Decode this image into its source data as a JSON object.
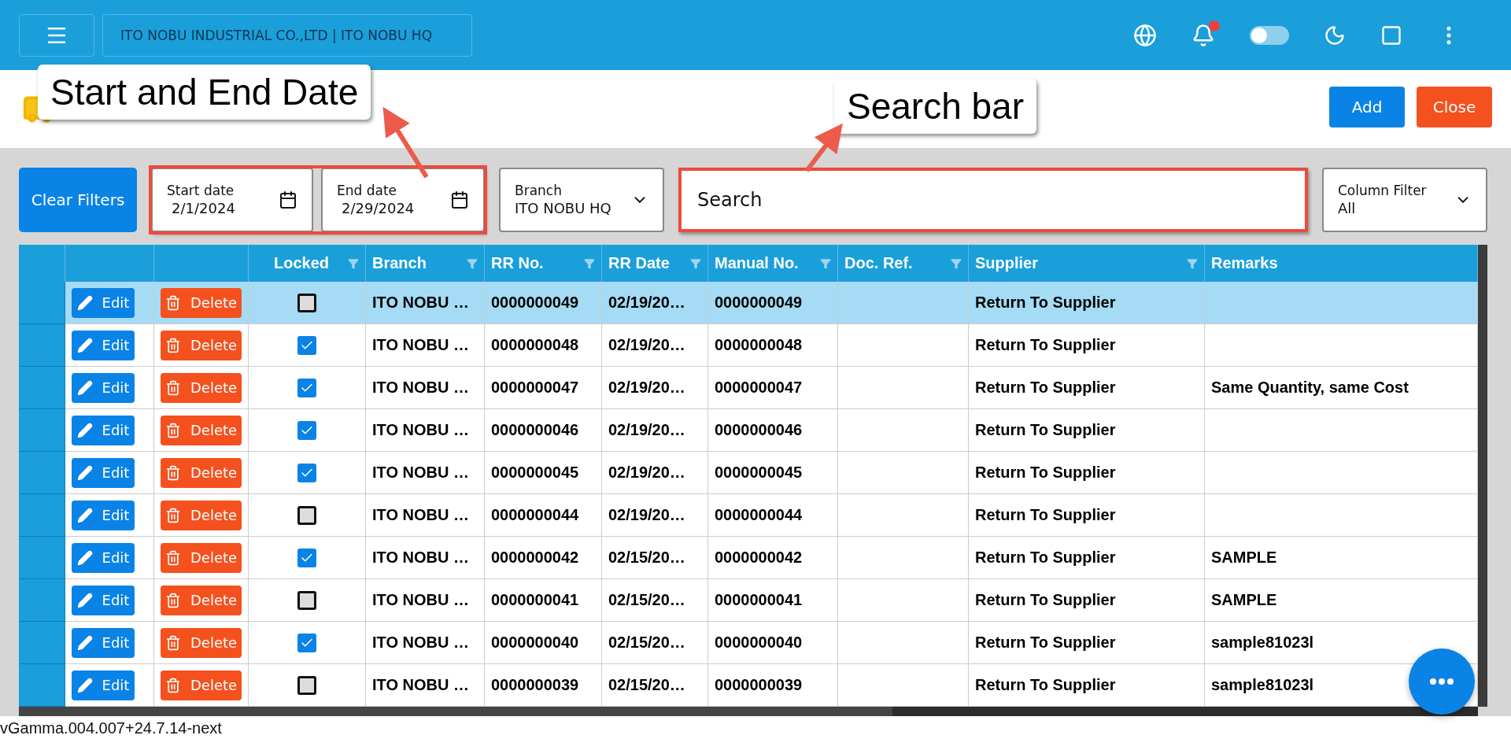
{
  "top_bar": {
    "company": "ITO NOBU INDUSTRIAL CO.,LTD | ITO NOBU HQ",
    "notification_badge": true,
    "toggle_on": false
  },
  "header": {
    "buttons": [
      {
        "kind": "primary",
        "label": "Add"
      },
      {
        "kind": "danger",
        "label": "Close"
      }
    ]
  },
  "filters": {
    "clear_button": "Clear Filters",
    "start_date": {
      "label": "Start date",
      "value": "2/1/2024"
    },
    "end_date": {
      "label": "End date",
      "value": "2/29/2024"
    },
    "branch": {
      "label": "Branch",
      "value": "ITO NOBU HQ"
    },
    "search": {
      "placeholder": "Search"
    },
    "column_filter": {
      "label": "Column Filter",
      "value": "All"
    }
  },
  "table": {
    "columns": [
      {
        "label": "Locked",
        "filter": true
      },
      {
        "label": "Branch",
        "filter": true
      },
      {
        "label": "RR No.",
        "filter": true
      },
      {
        "label": "RR Date",
        "filter": true
      },
      {
        "label": "Manual No.",
        "filter": true
      },
      {
        "label": "Doc. Ref.",
        "filter": true
      },
      {
        "label": "Supplier",
        "filter": true
      },
      {
        "label": "Remarks",
        "filter": false
      }
    ],
    "rows": [
      {
        "selected": true,
        "edit": "Edit",
        "delete": "Delete",
        "locked": false,
        "branch": "ITO NOBU …",
        "rr_no": "0000000049",
        "rr_date": "02/19/20…",
        "manual_no": "0000000049",
        "supplier": "Return To Supplier"
      },
      {
        "selected": false,
        "edit": "Edit",
        "delete": "Delete",
        "locked": true,
        "branch": "ITO NOBU …",
        "rr_no": "0000000048",
        "rr_date": "02/19/20…",
        "manual_no": "0000000048",
        "supplier": "Return To Supplier"
      },
      {
        "selected": false,
        "edit": "Edit",
        "delete": "Delete",
        "locked": true,
        "branch": "ITO NOBU …",
        "rr_no": "0000000047",
        "rr_date": "02/19/20…",
        "manual_no": "0000000047",
        "supplier": "Return To Supplier",
        "remarks": "Same Quantity, same Cost"
      },
      {
        "selected": false,
        "edit": "Edit",
        "delete": "Delete",
        "locked": true,
        "branch": "ITO NOBU …",
        "rr_no": "0000000046",
        "rr_date": "02/19/20…",
        "manual_no": "0000000046",
        "supplier": "Return To Supplier"
      },
      {
        "selected": false,
        "edit": "Edit",
        "delete": "Delete",
        "locked": true,
        "branch": "ITO NOBU …",
        "rr_no": "0000000045",
        "rr_date": "02/19/20…",
        "manual_no": "0000000045",
        "supplier": "Return To Supplier"
      },
      {
        "selected": false,
        "edit": "Edit",
        "delete": "Delete",
        "locked": false,
        "branch": "ITO NOBU …",
        "rr_no": "0000000044",
        "rr_date": "02/19/20…",
        "manual_no": "0000000044",
        "supplier": "Return To Supplier"
      },
      {
        "selected": false,
        "edit": "Edit",
        "delete": "Delete",
        "locked": true,
        "branch": "ITO NOBU …",
        "rr_no": "0000000042",
        "rr_date": "02/15/20…",
        "manual_no": "0000000042",
        "supplier": "Return To Supplier",
        "remarks": "SAMPLE"
      },
      {
        "selected": false,
        "edit": "Edit",
        "delete": "Delete",
        "locked": false,
        "branch": "ITO NOBU …",
        "rr_no": "0000000041",
        "rr_date": "02/15/20…",
        "manual_no": "0000000041",
        "supplier": "Return To Supplier",
        "remarks": "SAMPLE"
      },
      {
        "selected": false,
        "edit": "Edit",
        "delete": "Delete",
        "locked": true,
        "branch": "ITO NOBU …",
        "rr_no": "0000000040",
        "rr_date": "02/15/20…",
        "manual_no": "0000000040",
        "supplier": "Return To Supplier",
        "remarks": "sample81023l"
      },
      {
        "selected": false,
        "edit": "Edit",
        "delete": "Delete",
        "locked": false,
        "branch": "ITO NOBU …",
        "rr_no": "0000000039",
        "rr_date": "02/15/20…",
        "manual_no": "0000000039",
        "supplier": "Return To Supplier",
        "remarks": "sample81023l"
      }
    ]
  },
  "annotations": [
    {
      "kind": "dates",
      "text": "Start and End Date"
    },
    {
      "kind": "search",
      "text": "Search bar"
    }
  ],
  "footer": {
    "version": "vGamma.004.007+24.7.14-next"
  }
}
